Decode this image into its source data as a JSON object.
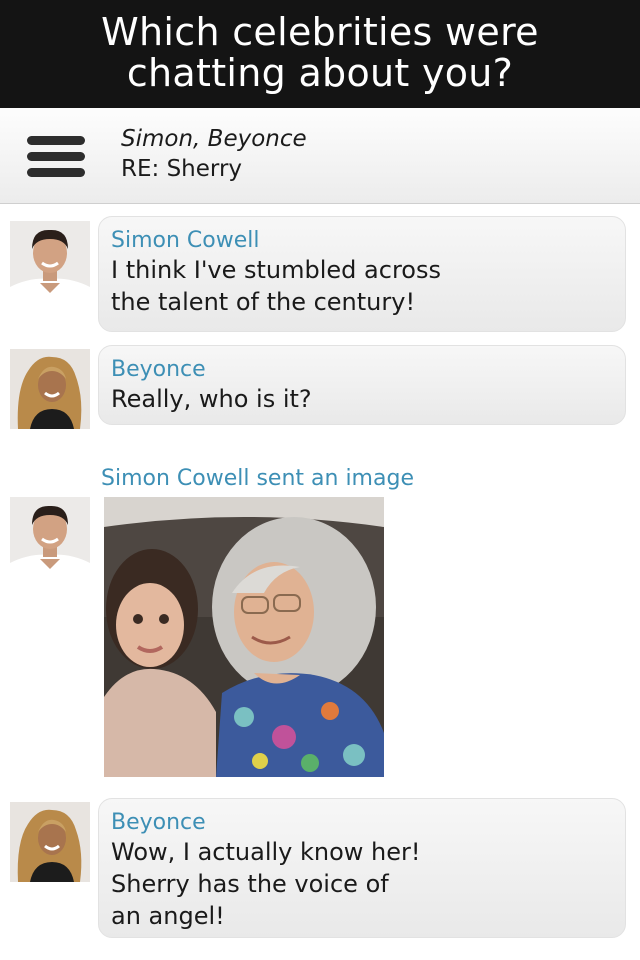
{
  "banner": {
    "line1": "Which celebrities were",
    "line2": "chatting about you?"
  },
  "header": {
    "menu_icon": "hamburger-menu-icon",
    "participants": "Simon, Beyonce",
    "subject": "RE: Sherry"
  },
  "messages": [
    {
      "avatar": "simon-cowell-avatar",
      "sender": "Simon Cowell",
      "lines": [
        "I think I've stumbled across",
        "the talent of the century!"
      ]
    },
    {
      "avatar": "beyonce-avatar",
      "sender": "Beyonce",
      "lines": [
        "Really, who is it?"
      ]
    },
    {
      "avatar": "simon-cowell-avatar",
      "caption": "Simon Cowell sent an image",
      "image": "photo-of-girl-and-sherry"
    },
    {
      "avatar": "beyonce-avatar",
      "sender": "Beyonce",
      "lines": [
        "Wow, I actually know her!",
        "Sherry has the voice of",
        "an angel!"
      ]
    }
  ],
  "colors": {
    "banner_bg": "#141414",
    "sender_name": "#3d8fb5",
    "bubble": "#efefef"
  }
}
